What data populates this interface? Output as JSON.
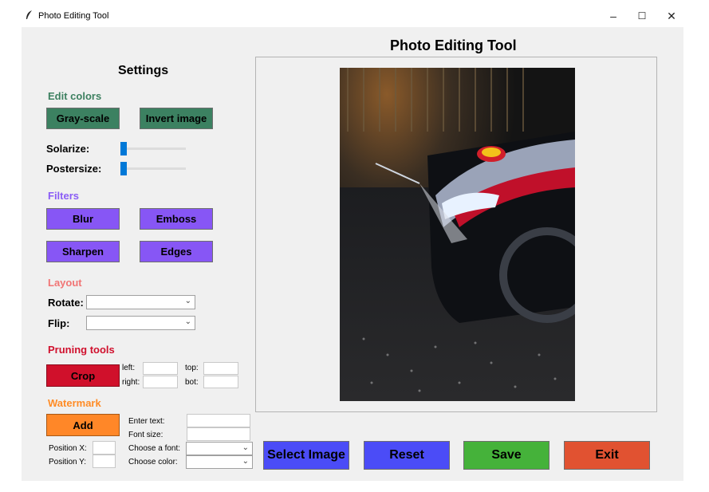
{
  "window": {
    "title": "Photo Editing Tool",
    "minimize": "–",
    "maximize": "☐",
    "close": "✕"
  },
  "header": {
    "title": "Photo Editing Tool"
  },
  "settings": {
    "title": "Settings",
    "edit_colors": {
      "heading": "Edit colors",
      "grayscale": "Gray-scale",
      "invert": "Invert image"
    },
    "solarize": {
      "label": "Solarize:",
      "value": 0
    },
    "postersize": {
      "label": "Postersize:",
      "value": 0
    },
    "filters": {
      "heading": "Filters",
      "blur": "Blur",
      "emboss": "Emboss",
      "sharpen": "Sharpen",
      "edges": "Edges"
    },
    "layout": {
      "heading": "Layout",
      "rotate_label": "Rotate:",
      "rotate_value": "",
      "flip_label": "Flip:",
      "flip_value": ""
    },
    "pruning": {
      "heading": "Pruning tools",
      "crop": "Crop",
      "left": "left:",
      "right": "right:",
      "top": "top:",
      "bot": "bot:"
    },
    "watermark": {
      "heading": "Watermark",
      "add": "Add",
      "enter_text": "Enter text:",
      "font_size": "Font size:",
      "choose_font": "Choose a font:",
      "choose_color": "Choose color:",
      "position_x": "Position X:",
      "position_y": "Position Y:"
    }
  },
  "actions": {
    "select": "Select Image",
    "reset": "Reset",
    "save": "Save",
    "exit": "Exit"
  },
  "colors": {
    "edit_colors": "#3d8060",
    "filters": "#8a5cf6",
    "layout": "#f17575",
    "pruning": "#d0102d",
    "watermark": "#ff8c26",
    "btn_green": "#3c8161",
    "btn_purple": "#8756f5",
    "btn_red": "#d0102b",
    "btn_orange": "#ff8728",
    "btn_blue": "#4b4cf7",
    "btn_save": "#45b23a",
    "btn_exit": "#e15231"
  },
  "image": {
    "alt": "",
    "icon": "photo-preview"
  }
}
